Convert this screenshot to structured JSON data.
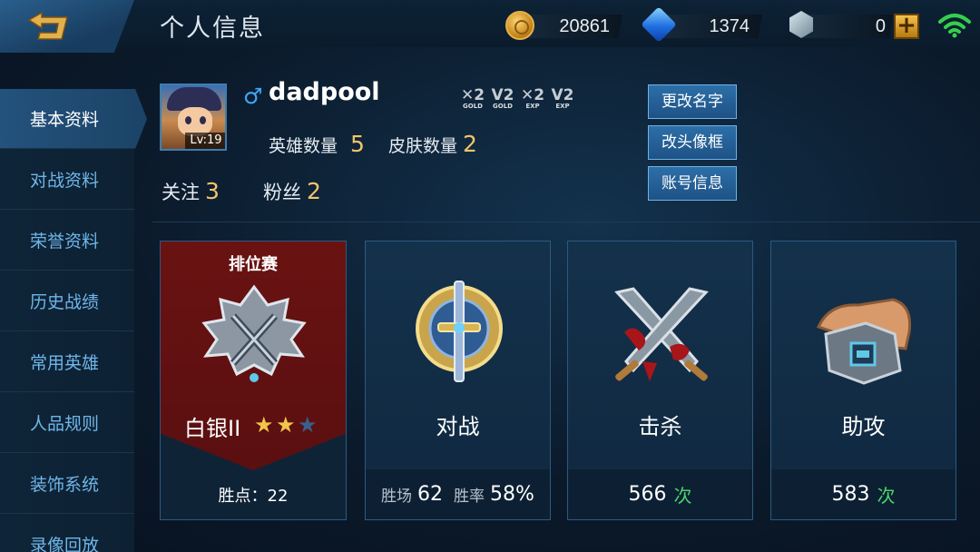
{
  "header": {
    "title": "个人信息",
    "gold": "20861",
    "diamonds": "1374",
    "vouchers": "0",
    "add_label": "+"
  },
  "sidebar": {
    "items": [
      {
        "label": "基本资料",
        "active": true
      },
      {
        "label": "对战资料"
      },
      {
        "label": "荣誉资料"
      },
      {
        "label": "历史战绩"
      },
      {
        "label": "常用英雄"
      },
      {
        "label": "人品规则"
      },
      {
        "label": "装饰系统"
      },
      {
        "label": "录像回放"
      }
    ]
  },
  "profile": {
    "gender_symbol": "♂",
    "name": "dadpool",
    "level": "Lv:19",
    "boosts": [
      {
        "top": "✕2",
        "bottom": "GOLD"
      },
      {
        "top": "V2",
        "bottom": "GOLD"
      },
      {
        "top": "✕2",
        "bottom": "EXP"
      },
      {
        "top": "V2",
        "bottom": "EXP"
      }
    ],
    "hero_count_label": "英雄数量",
    "hero_count": "5",
    "skin_count_label": "皮肤数量",
    "skin_count": "2",
    "follow_label": "关注",
    "follow_count": "3",
    "fans_label": "粉丝",
    "fans_count": "2"
  },
  "buttons": {
    "rename": "更改名字",
    "frame": "改头像框",
    "account": "账号信息"
  },
  "cards": {
    "rank": {
      "title": "排位赛",
      "name": "白银II",
      "stars_filled": 2,
      "stars_total": 3,
      "points_label": "胜点：",
      "points": "22"
    },
    "battle": {
      "label": "对战",
      "wins_label": "胜场",
      "wins": "62",
      "rate_label": "胜率",
      "rate": "58%"
    },
    "kills": {
      "label": "击杀",
      "value": "566",
      "unit": "次"
    },
    "assists": {
      "label": "助攻",
      "value": "583",
      "unit": "次"
    }
  },
  "colors": {
    "accent_gold": "#f2c46a",
    "unit_green": "#4cd36a",
    "rank_red": "#6a1212",
    "panel_blue": "#14314b"
  }
}
